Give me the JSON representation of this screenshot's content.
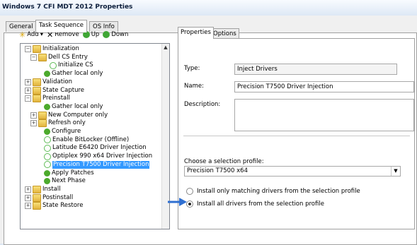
{
  "window": {
    "title": "Windows 7 CFI MDT 2012 Properties"
  },
  "tabs": [
    {
      "label": "General"
    },
    {
      "label": "Task Sequence"
    },
    {
      "label": "OS Info"
    }
  ],
  "toolbar": {
    "add_label": "Add",
    "add_caret": "▾",
    "remove_label": "Remove",
    "up_label": "Up",
    "down_label": "Down"
  },
  "tree": {
    "items": [
      {
        "label": "Initialization",
        "icon": "folder-icon",
        "expander": "−"
      },
      {
        "label": "Dell CS Entry",
        "icon": "folder-icon",
        "expander": "−"
      },
      {
        "label": "Initialize CS",
        "icon": "check-disabled-icon"
      },
      {
        "label": "Gather local only",
        "icon": "check-icon"
      },
      {
        "label": "Validation",
        "icon": "folder-icon",
        "expander": "+"
      },
      {
        "label": "State Capture",
        "icon": "folder-icon",
        "expander": "+"
      },
      {
        "label": "Preinstall",
        "icon": "folder-icon",
        "expander": "−"
      },
      {
        "label": "Gather local only",
        "icon": "check-icon"
      },
      {
        "label": "New Computer only",
        "icon": "folder-icon",
        "expander": "+"
      },
      {
        "label": "Refresh only",
        "icon": "folder-icon",
        "expander": "+"
      },
      {
        "label": "Configure",
        "icon": "check-icon"
      },
      {
        "label": "Enable BitLocker (Offline)",
        "icon": "check-disabled-icon"
      },
      {
        "label": "Latitude E6420 Driver Injection",
        "icon": "check-disabled-icon"
      },
      {
        "label": "Optiplex 990 x64 Driver Injection",
        "icon": "check-disabled-icon"
      },
      {
        "label": "Precision T7500 Driver Injection",
        "icon": "check-disabled-icon",
        "selected": true
      },
      {
        "label": "Apply Patches",
        "icon": "check-icon"
      },
      {
        "label": "Next Phase",
        "icon": "check-icon"
      },
      {
        "label": "Install",
        "icon": "folder-icon",
        "expander": "+"
      },
      {
        "label": "Postinstall",
        "icon": "folder-icon",
        "expander": "+"
      },
      {
        "label": "State Restore",
        "icon": "folder-icon",
        "expander": "+"
      }
    ]
  },
  "right_tabs": [
    {
      "label": "Properties"
    },
    {
      "label": "Options"
    }
  ],
  "properties": {
    "type_label": "Type:",
    "type_value": "Inject Drivers",
    "name_label": "Name:",
    "name_value": "Precision T7500 Driver Injection",
    "description_label": "Description:",
    "description_value": "",
    "profile_label": "Choose a selection profile:",
    "profile_value": "Precision T7500 x64",
    "radio_matching": "Install only matching drivers from the selection profile",
    "radio_all": "Install all drivers from the selection profile",
    "radio_all_selected": true
  },
  "colors": {
    "selection": "#3399ff",
    "arrow": "#2f6fd1"
  }
}
